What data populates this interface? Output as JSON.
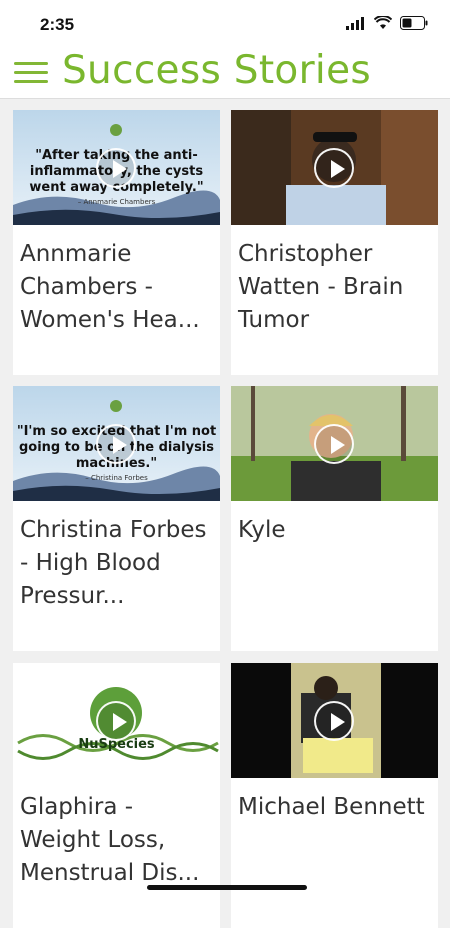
{
  "status": {
    "time": "2:35"
  },
  "header": {
    "title": "Success Stories",
    "menu_icon": "hamburger-menu-icon"
  },
  "stories": [
    {
      "title": "Annmarie Chambers - Women's Hea...",
      "quote": "\"After taking the anti-inflammatory, the cysts went away completely.\"",
      "cite": "– Annmarie Chambers"
    },
    {
      "title": "Christopher Watten - Brain Tumor"
    },
    {
      "title": "Christina Forbes - High Blood Pressur...",
      "quote": "\"I'm so excited that I'm not going to be on the dialysis machines.\"",
      "cite": "– Christina Forbes"
    },
    {
      "title": "Kyle"
    },
    {
      "title": "Glaphira - Weight Loss, Menstrual Dis...",
      "logo": "NuSpecies"
    },
    {
      "title": "Michael Bennett"
    }
  ],
  "colors": {
    "brand_green": "#7ab72e"
  }
}
